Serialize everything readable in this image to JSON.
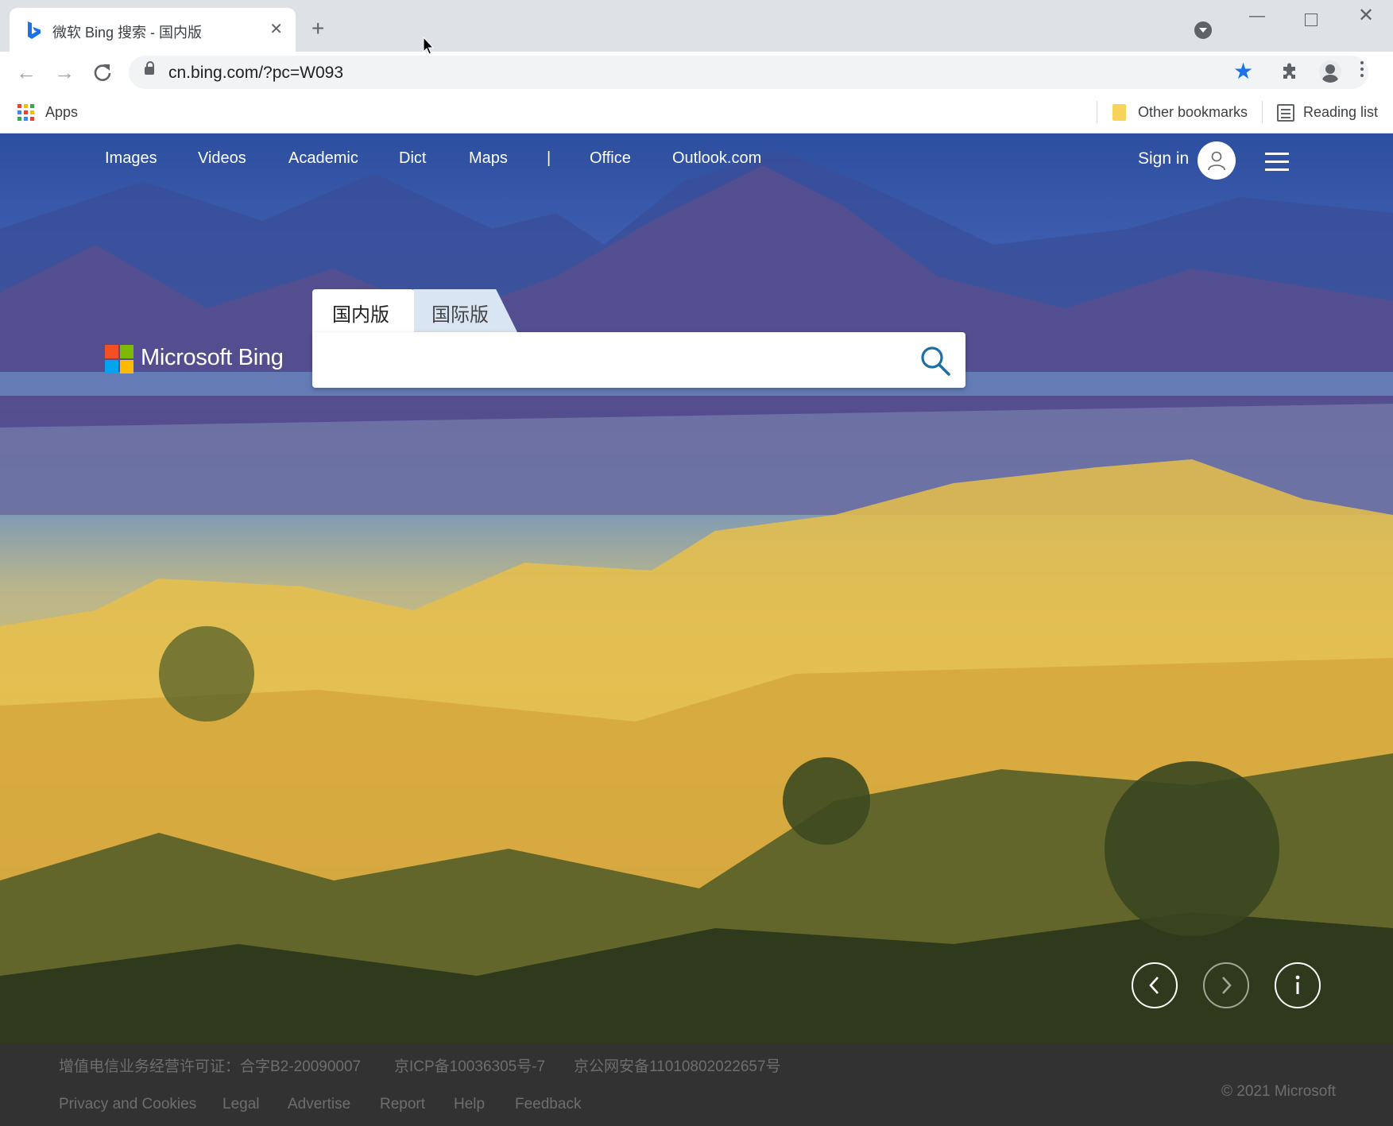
{
  "browser": {
    "tab_title": "微软 Bing 搜索 - 国内版",
    "tab_close": "✕",
    "new_tab": "+",
    "url": "cn.bing.com/?pc=W093",
    "star": "★"
  },
  "bookmarks": {
    "apps": "Apps",
    "other": "Other bookmarks",
    "reading": "Reading list"
  },
  "nav": {
    "items": [
      "Images",
      "Videos",
      "Academic",
      "Dict",
      "Maps",
      "|",
      "Office",
      "Outlook.com"
    ],
    "sign_in": "Sign in"
  },
  "logo": {
    "text": "Microsoft Bing"
  },
  "search": {
    "tabs": [
      "国内版",
      "国际版"
    ],
    "placeholder": ""
  },
  "footer": {
    "licenses": [
      "增值电信业务经营许可证：合字B2-20090007",
      "京ICP备10036305号-7",
      "京公网安备11010802022657号"
    ],
    "links": [
      "Privacy and Cookies",
      "Legal",
      "Advertise",
      "Report",
      "Help",
      "Feedback"
    ],
    "copyright": "© 2021 Microsoft"
  },
  "colors": {
    "accent": "#1a73e8",
    "bing_search_icon": "#1e6fa8",
    "footer_bg": "#323232",
    "footer_text": "#6e6e6e"
  },
  "icons": [
    "bing-favicon",
    "close-icon",
    "plus-icon",
    "tab-search-icon",
    "minimize-icon",
    "maximize-icon",
    "window-close-icon",
    "back-arrow-icon",
    "forward-arrow-icon",
    "reload-icon",
    "lock-icon",
    "star-icon",
    "extensions-icon",
    "profile-icon",
    "menu-icon",
    "apps-grid-icon",
    "folder-icon",
    "reading-list-icon",
    "user-icon",
    "hamburger-icon",
    "microsoft-logo-icon",
    "search-icon",
    "chevron-left-icon",
    "chevron-right-icon",
    "info-icon"
  ]
}
